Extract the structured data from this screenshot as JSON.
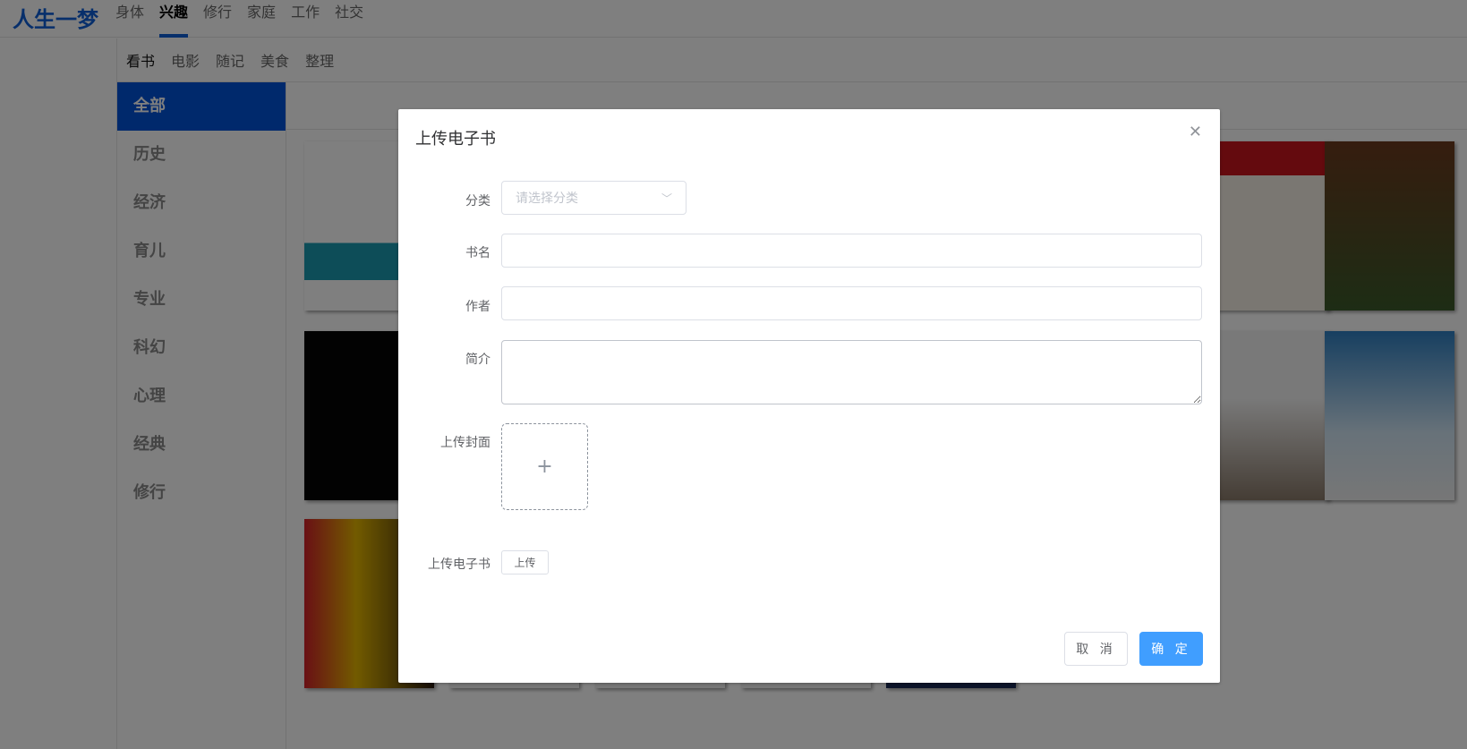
{
  "header": {
    "logo": "人生一梦",
    "nav": [
      "身体",
      "兴趣",
      "修行",
      "家庭",
      "工作",
      "社交"
    ],
    "active_nav": "兴趣"
  },
  "subnav": {
    "items": [
      "看书",
      "电影",
      "随记",
      "美食",
      "整理"
    ],
    "active": "看书"
  },
  "sidebar": {
    "items": [
      "全部",
      "历史",
      "经济",
      "育儿",
      "专业",
      "科幻",
      "心理",
      "经典",
      "修行"
    ],
    "active": "全部"
  },
  "modal": {
    "title": "上传电子书",
    "close_icon": "close-icon",
    "category_label": "分类",
    "category_placeholder": "请选择分类",
    "name_label": "书名",
    "name_value": "",
    "author_label": "作者",
    "author_value": "",
    "intro_label": "简介",
    "intro_value": "",
    "cover_label": "上传封面",
    "cover_icon": "plus-icon",
    "ebook_label": "上传电子书",
    "ebook_button": "上传",
    "cancel": "取 消",
    "confirm": "确 定"
  },
  "colors": {
    "brand": "#0f5fd6",
    "primary_button": "#409eff",
    "overlay": "rgba(0,0,0,0.5)"
  }
}
